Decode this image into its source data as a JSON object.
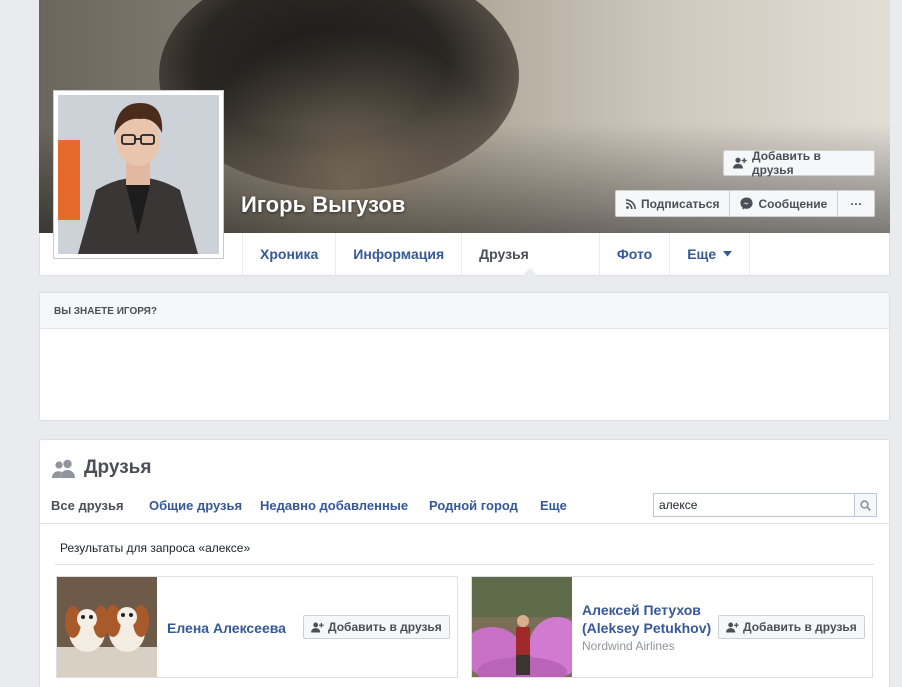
{
  "profile": {
    "name": "Игорь Выгузов",
    "add_friend_label": "Добавить в друзья",
    "subscribe_label": "Подписаться",
    "message_label": "Сообщение",
    "more_label": "···"
  },
  "tabs": [
    {
      "label": "Хроника"
    },
    {
      "label": "Информация"
    },
    {
      "label": "Друзья"
    },
    {
      "label": "Фото"
    },
    {
      "label": "Еще"
    }
  ],
  "know": {
    "heading": "ВЫ ЗНАЕТЕ ИГОРЯ?"
  },
  "friends": {
    "title": "Друзья",
    "tabs": [
      {
        "label": "Все друзья"
      },
      {
        "label": "Общие друзья"
      },
      {
        "label": "Недавно добавленные"
      },
      {
        "label": "Родной город"
      },
      {
        "label": "Еще"
      }
    ],
    "search_value": "алексе",
    "results_text": "Результаты для запроса «алексе»",
    "items": [
      {
        "name": "Елена Алексеева",
        "subtitle": "",
        "add_label": "Добавить в друзья"
      },
      {
        "name": "Алексей Петухов (Aleksey Petukhov)",
        "subtitle": "Nordwind Airlines",
        "add_label": "Добавить в друзья"
      }
    ]
  },
  "colors": {
    "link": "#365899",
    "text": "#4b4f56",
    "page_bg": "#e9ebee"
  }
}
